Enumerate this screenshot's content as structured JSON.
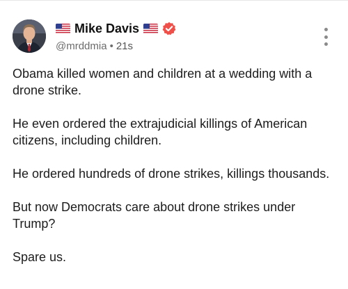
{
  "post": {
    "author": {
      "display_name": "Mike Davis",
      "handle": "@mrddmia",
      "verified": true,
      "flag_emoji": "US flag"
    },
    "separator": "•",
    "timestamp": "21s",
    "more_icon": "more-vertical-icon",
    "paragraphs": [
      "Obama killed women and children at a wedding with a drone strike.",
      "He even ordered the extrajudicial killings of American citizens, including children.",
      "He ordered hundreds of drone strikes, killings thousands.",
      "But now Democrats care about drone strikes under Trump?",
      "Spare us."
    ]
  },
  "colors": {
    "verified_badge": "#f0504a",
    "text": "#1c1c1c",
    "meta": "#6b6b6b"
  }
}
